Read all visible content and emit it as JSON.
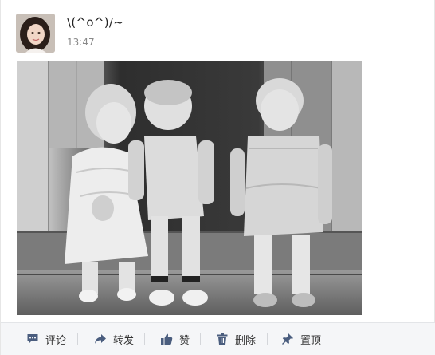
{
  "post": {
    "username": "\\(^o^)/~",
    "time": "13:47"
  },
  "actions": [
    {
      "label": "评论",
      "icon": "comment-icon"
    },
    {
      "label": "转发",
      "icon": "forward-icon"
    },
    {
      "label": "赞",
      "icon": "thumbs-up-icon"
    },
    {
      "label": "删除",
      "icon": "trash-icon"
    },
    {
      "label": "置顶",
      "icon": "pin-icon"
    }
  ],
  "colors": {
    "icon": "#4a5d7e",
    "text": "#333333",
    "toolbar_bg": "#f5f6f8"
  }
}
